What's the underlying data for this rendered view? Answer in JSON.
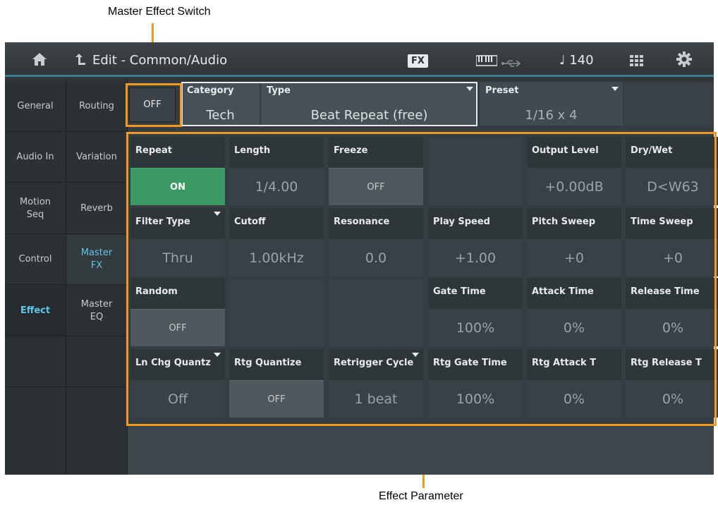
{
  "annotations": {
    "master_switch_label": "Master Effect Switch",
    "effect_param_label": "Effect Parameter"
  },
  "topbar": {
    "title": "Edit - Common/Audio",
    "fx_badge": "FX",
    "tempo": "♩ 140",
    "icons": [
      "home-icon",
      "back-icon",
      "keyboard-icon",
      "usb-icon",
      "grid-icon",
      "gear-icon"
    ]
  },
  "nav_main": [
    {
      "label": "General"
    },
    {
      "label": "Audio In"
    },
    {
      "label": "Motion\nSeq"
    },
    {
      "label": "Control"
    },
    {
      "label": "Effect"
    }
  ],
  "nav_sub": [
    {
      "label": "Routing"
    },
    {
      "label": "Variation"
    },
    {
      "label": "Reverb"
    },
    {
      "label": "Master\nFX"
    },
    {
      "label": "Master\nEQ"
    }
  ],
  "header": {
    "master_switch": "OFF",
    "category_label": "Category",
    "category_value": "Tech",
    "type_label": "Type",
    "type_value": "Beat Repeat (free)",
    "preset_label": "Preset",
    "preset_value": "1/16 x 4"
  },
  "params": [
    [
      {
        "title": "Repeat",
        "value": "ON",
        "kind": "button-on"
      },
      {
        "title": "Length",
        "value": "1/4.00",
        "kind": "value"
      },
      {
        "title": "Freeze",
        "value": "OFF",
        "kind": "button"
      },
      {
        "title": "",
        "value": "",
        "kind": "empty"
      },
      {
        "title": "Output Level",
        "value": "+0.00dB",
        "kind": "value"
      },
      {
        "title": "Dry/Wet",
        "value": "D<W63",
        "kind": "value"
      }
    ],
    [
      {
        "title": "Filter Type",
        "value": "Thru",
        "kind": "value",
        "dropdown": true
      },
      {
        "title": "Cutoff",
        "value": "1.00kHz",
        "kind": "value"
      },
      {
        "title": "Resonance",
        "value": "0.0",
        "kind": "value"
      },
      {
        "title": "Play Speed",
        "value": "+1.00",
        "kind": "value"
      },
      {
        "title": "Pitch Sweep",
        "value": "+0",
        "kind": "value"
      },
      {
        "title": "Time Sweep",
        "value": "+0",
        "kind": "value"
      }
    ],
    [
      {
        "title": "Random",
        "value": "OFF",
        "kind": "button"
      },
      {
        "title": "",
        "value": "",
        "kind": "empty"
      },
      {
        "title": "",
        "value": "",
        "kind": "empty"
      },
      {
        "title": "Gate Time",
        "value": "100%",
        "kind": "value"
      },
      {
        "title": "Attack Time",
        "value": "0%",
        "kind": "value"
      },
      {
        "title": "Release Time",
        "value": "0%",
        "kind": "value"
      }
    ],
    [
      {
        "title": "Ln Chg Quantz",
        "value": "Off",
        "kind": "value",
        "dropdown": true
      },
      {
        "title": "Rtg Quantize",
        "value": "OFF",
        "kind": "button"
      },
      {
        "title": "Retrigger Cycle",
        "value": "1 beat",
        "kind": "value",
        "dropdown": true
      },
      {
        "title": "Rtg Gate Time",
        "value": "100%",
        "kind": "value"
      },
      {
        "title": "Rtg Attack T",
        "value": "0%",
        "kind": "value"
      },
      {
        "title": "Rtg Release T",
        "value": "0%",
        "kind": "value"
      }
    ]
  ],
  "colors": {
    "accent": "#5fc6ea",
    "callout": "#f29a1f",
    "on_button": "#3b9a63"
  }
}
